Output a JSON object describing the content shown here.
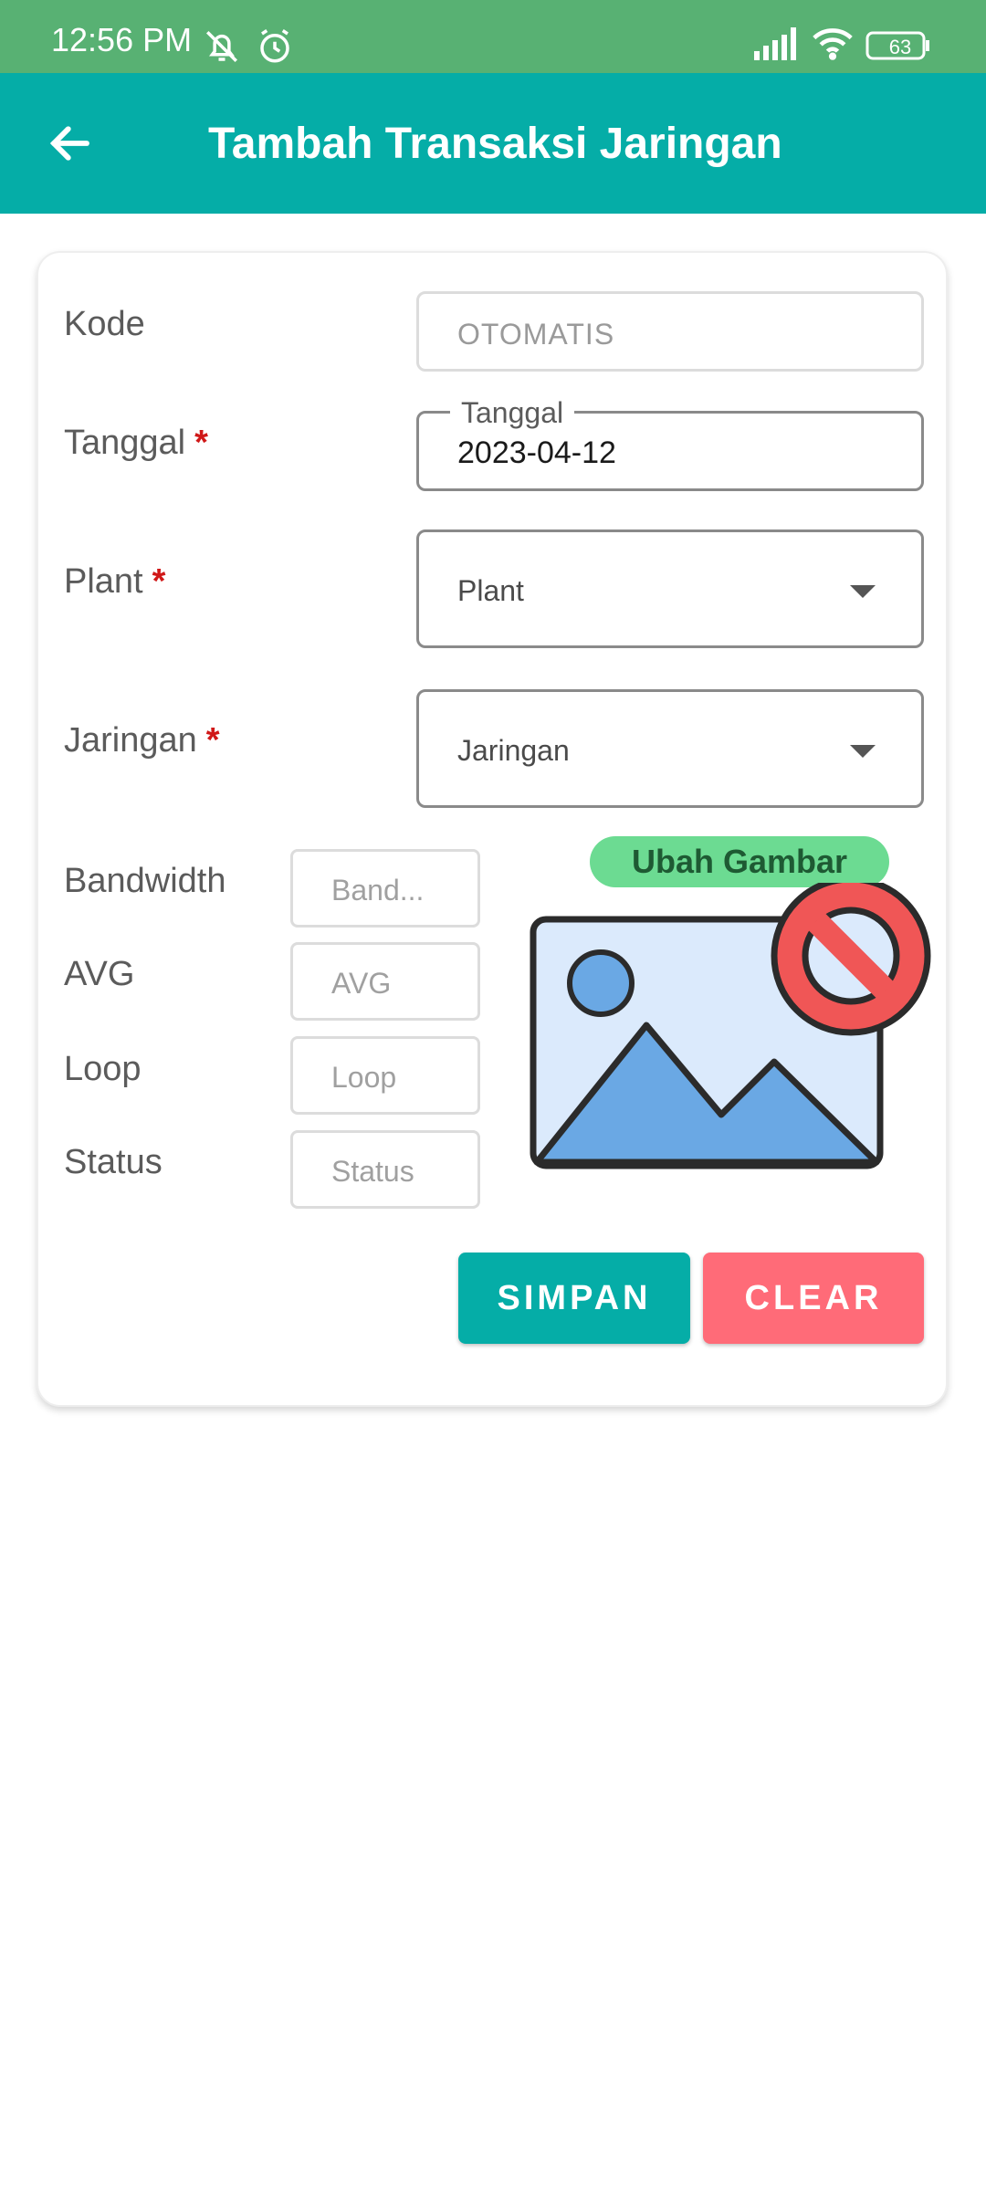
{
  "status_bar": {
    "time": "12:56 PM",
    "battery": "63",
    "icons": [
      "bell-off-icon",
      "alarm-icon",
      "signal-icon",
      "wifi-icon",
      "battery-icon"
    ]
  },
  "app_bar": {
    "title": "Tambah Transaksi Jaringan",
    "back_icon": "arrow-left-icon",
    "color": "#05ada7"
  },
  "form": {
    "kode": {
      "label": "Kode",
      "placeholder": "OTOMATIS"
    },
    "tanggal": {
      "label": "Tanggal",
      "required_mark": "*",
      "legend": "Tanggal",
      "value": "2023-04-12"
    },
    "plant": {
      "label": "Plant",
      "required_mark": "*",
      "selected": "Plant"
    },
    "jaringan": {
      "label": "Jaringan",
      "required_mark": "*",
      "selected": "Jaringan"
    },
    "bandwidth": {
      "label": "Bandwidth",
      "placeholder": "Band..."
    },
    "avg": {
      "label": "AVG",
      "placeholder": "AVG"
    },
    "loop": {
      "label": "Loop",
      "placeholder": "Loop"
    },
    "status": {
      "label": "Status",
      "placeholder": "Status"
    }
  },
  "image": {
    "change_label": "Ubah Gambar",
    "icon": "no-image-icon"
  },
  "actions": {
    "save_label": "SIMPAN",
    "clear_label": "CLEAR",
    "save_color": "#05ada7",
    "clear_color": "#ff6b78"
  }
}
